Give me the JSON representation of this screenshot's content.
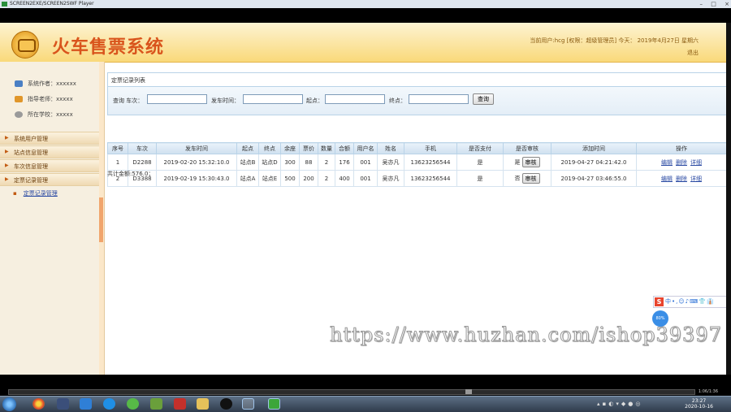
{
  "window": {
    "title": "SCREEN2EXE/SCREEN2SWF Player",
    "controls": [
      "–",
      "□",
      "×"
    ]
  },
  "app": {
    "title": "火车售票系统",
    "user_info": "当前用户:hcg [权限：超级管理员] 今天： 2019年4月27日 星期六",
    "logout": "退出"
  },
  "sidebar": {
    "info": [
      {
        "label": "系统作者：xxxxxx",
        "icon": "author-icon"
      },
      {
        "label": "指导老师：xxxxx",
        "icon": "teacher-icon"
      },
      {
        "label": "所在学校：xxxxx",
        "icon": "school-icon"
      }
    ],
    "menus": [
      {
        "label": "系统用户管理"
      },
      {
        "label": "站点信息管理"
      },
      {
        "label": "车次信息管理"
      },
      {
        "label": "定票记录管理"
      }
    ],
    "submenu": {
      "label": "定票记录管理"
    }
  },
  "panel": {
    "title": "定票记录列表"
  },
  "search": {
    "train_label": "查询 车次：",
    "time_label": "发车时间：",
    "start_label": "起点：",
    "end_label": "终点：",
    "train_value": "",
    "time_value": "",
    "start_value": "",
    "end_value": "",
    "button": "查询"
  },
  "table": {
    "headers": [
      "序号",
      "车次",
      "发车时间",
      "起点",
      "终点",
      "余座",
      "票价",
      "数量",
      "合额",
      "用户名",
      "姓名",
      "手机",
      "是否支付",
      "是否审核",
      "添加时间",
      "操作"
    ],
    "rows": [
      {
        "no": "1",
        "train": "D2288",
        "depart": "2019-02-20 15:32:10.0",
        "start": "站点B",
        "end": "站点D",
        "seats": "300",
        "price": "88",
        "qty": "2",
        "total": "176",
        "user": "001",
        "name": "吴亦凡",
        "phone": "13623256544",
        "paid": "是",
        "audited": "是",
        "audit_btn": "审核",
        "added": "2019-04-27 04:21:42.0",
        "ops": [
          "编辑",
          "删除",
          "详细"
        ]
      },
      {
        "no": "2",
        "train": "D3388",
        "depart": "2019-02-19 15:30:43.0",
        "start": "站点A",
        "end": "站点E",
        "seats": "500",
        "price": "200",
        "qty": "2",
        "total": "400",
        "user": "001",
        "name": "吴亦凡",
        "phone": "13623256544",
        "paid": "是",
        "audited": "否",
        "audit_btn": "审核",
        "added": "2019-04-27 03:46:55.0",
        "ops": [
          "编辑",
          "删除",
          "详细"
        ]
      }
    ],
    "summary": "共计金额:576.0；"
  },
  "watermark": "https://www.huzhan.com/ishop39397",
  "ime": {
    "logo": "S",
    "rest": "中•,☺♪⌨👕👔"
  },
  "bubble": "80%",
  "player": {
    "time": "1:06/1:36"
  },
  "taskbar": {
    "clock_time": "23:27",
    "clock_date": "2020-10-16"
  },
  "colors": {
    "accent": "#d9541c",
    "header_bg": "#f9d97a",
    "link": "#2a4aa3"
  }
}
